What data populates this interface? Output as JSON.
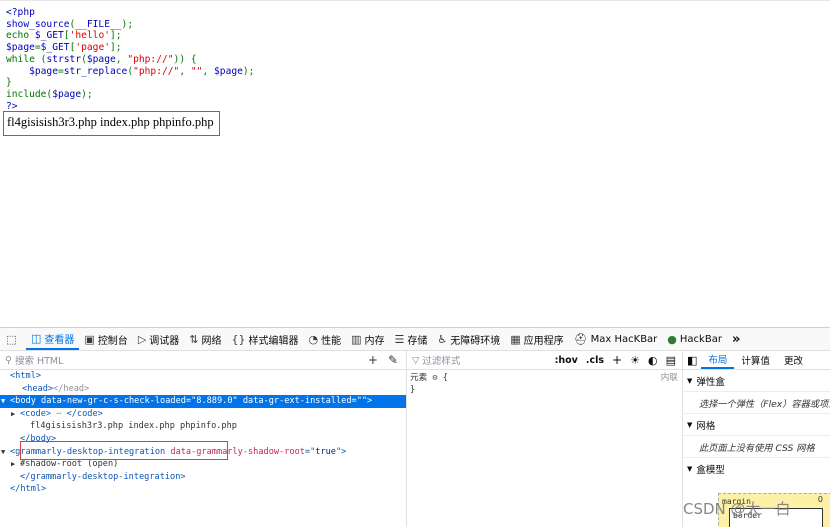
{
  "page": {
    "source_lines": [
      {
        "segs": [
          [
            "ph",
            "<?php"
          ]
        ]
      },
      {
        "segs": [
          [
            "ph",
            "show_source"
          ],
          [
            "kw",
            "("
          ],
          [
            "ph",
            "__FILE__"
          ],
          [
            "kw",
            ");"
          ]
        ]
      },
      {
        "segs": [
          [
            "kw",
            "echo "
          ],
          [
            "ph",
            "$_GET"
          ],
          [
            "kw",
            "["
          ],
          [
            "st",
            "'hello'"
          ],
          [
            "kw",
            "];"
          ]
        ]
      },
      {
        "segs": [
          [
            "ph",
            "$page"
          ],
          [
            "kw",
            "="
          ],
          [
            "ph",
            "$_GET"
          ],
          [
            "kw",
            "["
          ],
          [
            "st",
            "'page'"
          ],
          [
            "kw",
            "];"
          ]
        ]
      },
      {
        "segs": [
          [
            "kw",
            "while ("
          ],
          [
            "ph",
            "strstr"
          ],
          [
            "kw",
            "("
          ],
          [
            "ph",
            "$page"
          ],
          [
            "kw",
            ", "
          ],
          [
            "st",
            "\"php://\""
          ],
          [
            "kw",
            ")) {"
          ]
        ]
      },
      {
        "segs": [
          [
            "kw",
            "    "
          ],
          [
            "ph",
            "$page"
          ],
          [
            "kw",
            "="
          ],
          [
            "ph",
            "str_replace"
          ],
          [
            "kw",
            "("
          ],
          [
            "st",
            "\"php://\""
          ],
          [
            "kw",
            ", "
          ],
          [
            "st",
            "\"\""
          ],
          [
            "kw",
            ", "
          ],
          [
            "ph",
            "$page"
          ],
          [
            "kw",
            ");"
          ]
        ]
      },
      {
        "segs": [
          [
            "kw",
            "}"
          ]
        ]
      },
      {
        "segs": [
          [
            "kw",
            "include("
          ],
          [
            "ph",
            "$page"
          ],
          [
            "kw",
            ");"
          ]
        ]
      },
      {
        "segs": [
          [
            "ph",
            "?>"
          ]
        ]
      }
    ],
    "output_text": "fl4gisisish3r3.php index.php phpinfo.php"
  },
  "devtools": {
    "toolbar": {
      "tabs": [
        {
          "icon": "inspector-icon",
          "glyph": "◫",
          "label": "查看器",
          "selected": true
        },
        {
          "icon": "console-icon",
          "glyph": "▣",
          "label": "控制台"
        },
        {
          "icon": "debugger-icon",
          "glyph": "▷",
          "label": "调试器"
        },
        {
          "icon": "network-icon",
          "glyph": "⇅",
          "label": "网络"
        },
        {
          "icon": "style-editor-icon",
          "glyph": "{}",
          "label": "样式编辑器"
        },
        {
          "icon": "performance-icon",
          "glyph": "◔",
          "label": "性能"
        },
        {
          "icon": "memory-icon",
          "glyph": "▥",
          "label": "内存"
        },
        {
          "icon": "storage-icon",
          "glyph": "☰",
          "label": "存储"
        },
        {
          "icon": "accessibility-icon",
          "glyph": "♿",
          "label": "无障碍环境"
        },
        {
          "icon": "application-icon",
          "glyph": "▦",
          "label": "应用程序"
        },
        {
          "icon": "maxhackbar-icon",
          "glyph": "⛑",
          "label": "Max HacKBar"
        },
        {
          "icon": "hackbar-icon",
          "glyph": "●",
          "label": "HackBar"
        }
      ],
      "overflow_glyph": "»"
    },
    "inspector": {
      "search_placeholder": "搜索 HTML",
      "nodes": [
        {
          "indent": 10,
          "parts": [
            [
              "tag",
              "<html>"
            ]
          ]
        },
        {
          "indent": 22,
          "parts": [
            [
              "tag",
              "<head>"
            ],
            [
              "dim",
              "</head>"
            ]
          ]
        },
        {
          "indent": 10,
          "arrow": "▼",
          "hl": true,
          "parts": [
            [
              "tag",
              "<body "
            ],
            [
              "attr",
              "data-new-gr-c-s-check-loaded"
            ],
            [
              "tag",
              "=\""
            ],
            [
              "val",
              "8.889.0"
            ],
            [
              "tag",
              "\" "
            ],
            [
              "attr",
              "data-gr-ext-installed"
            ],
            [
              "tag",
              "=\"\">"
            ]
          ]
        },
        {
          "indent": 20,
          "arrow": "▶",
          "parts": [
            [
              "tag",
              "<code>"
            ],
            [
              "dim",
              " ⋯ "
            ],
            [
              "tag",
              "</code>"
            ]
          ]
        },
        {
          "indent": 30,
          "parts": [
            [
              "txt",
              "fl4gisisish3r3.php index.php phpinfo.php"
            ]
          ]
        },
        {
          "indent": 20,
          "parts": [
            [
              "tag",
              "</body>"
            ]
          ]
        },
        {
          "indent": 10,
          "arrow": "▼",
          "parts": [
            [
              "tag",
              "<grammarly-desktop-integration "
            ],
            [
              "attr",
              "data-grammarly-shadow-root"
            ],
            [
              "tag",
              "=\""
            ],
            [
              "val",
              "true"
            ],
            [
              "tag",
              "\">"
            ]
          ]
        },
        {
          "indent": 20,
          "arrow": "▶",
          "parts": [
            [
              "txt",
              "#shadow-root (open)"
            ]
          ]
        },
        {
          "indent": 20,
          "parts": [
            [
              "tag",
              "</grammarly-desktop-integration>"
            ]
          ]
        },
        {
          "indent": 10,
          "parts": [
            [
              "tag",
              "</html>"
            ]
          ]
        }
      ]
    },
    "rules": {
      "filter_placeholder": "过滤样式",
      "hov": ":hov",
      "cls": ".cls",
      "element_label": "元素",
      "brace_open": "{",
      "brace_close": "}",
      "inline_label": "内联"
    },
    "layout": {
      "tabs": [
        "布局",
        "计算值",
        "更改"
      ],
      "sections": [
        {
          "title": "弹性盒",
          "desc": "选择一个弹性（Flex）容器或项目以继续。"
        },
        {
          "title": "网格",
          "desc": "此页面上没有使用 CSS 网格"
        },
        {
          "title": "盒模型",
          "desc": ""
        }
      ],
      "box_label": "margin",
      "box_value": "0",
      "border_label": "border"
    }
  },
  "watermark": "CSDN @大一白"
}
